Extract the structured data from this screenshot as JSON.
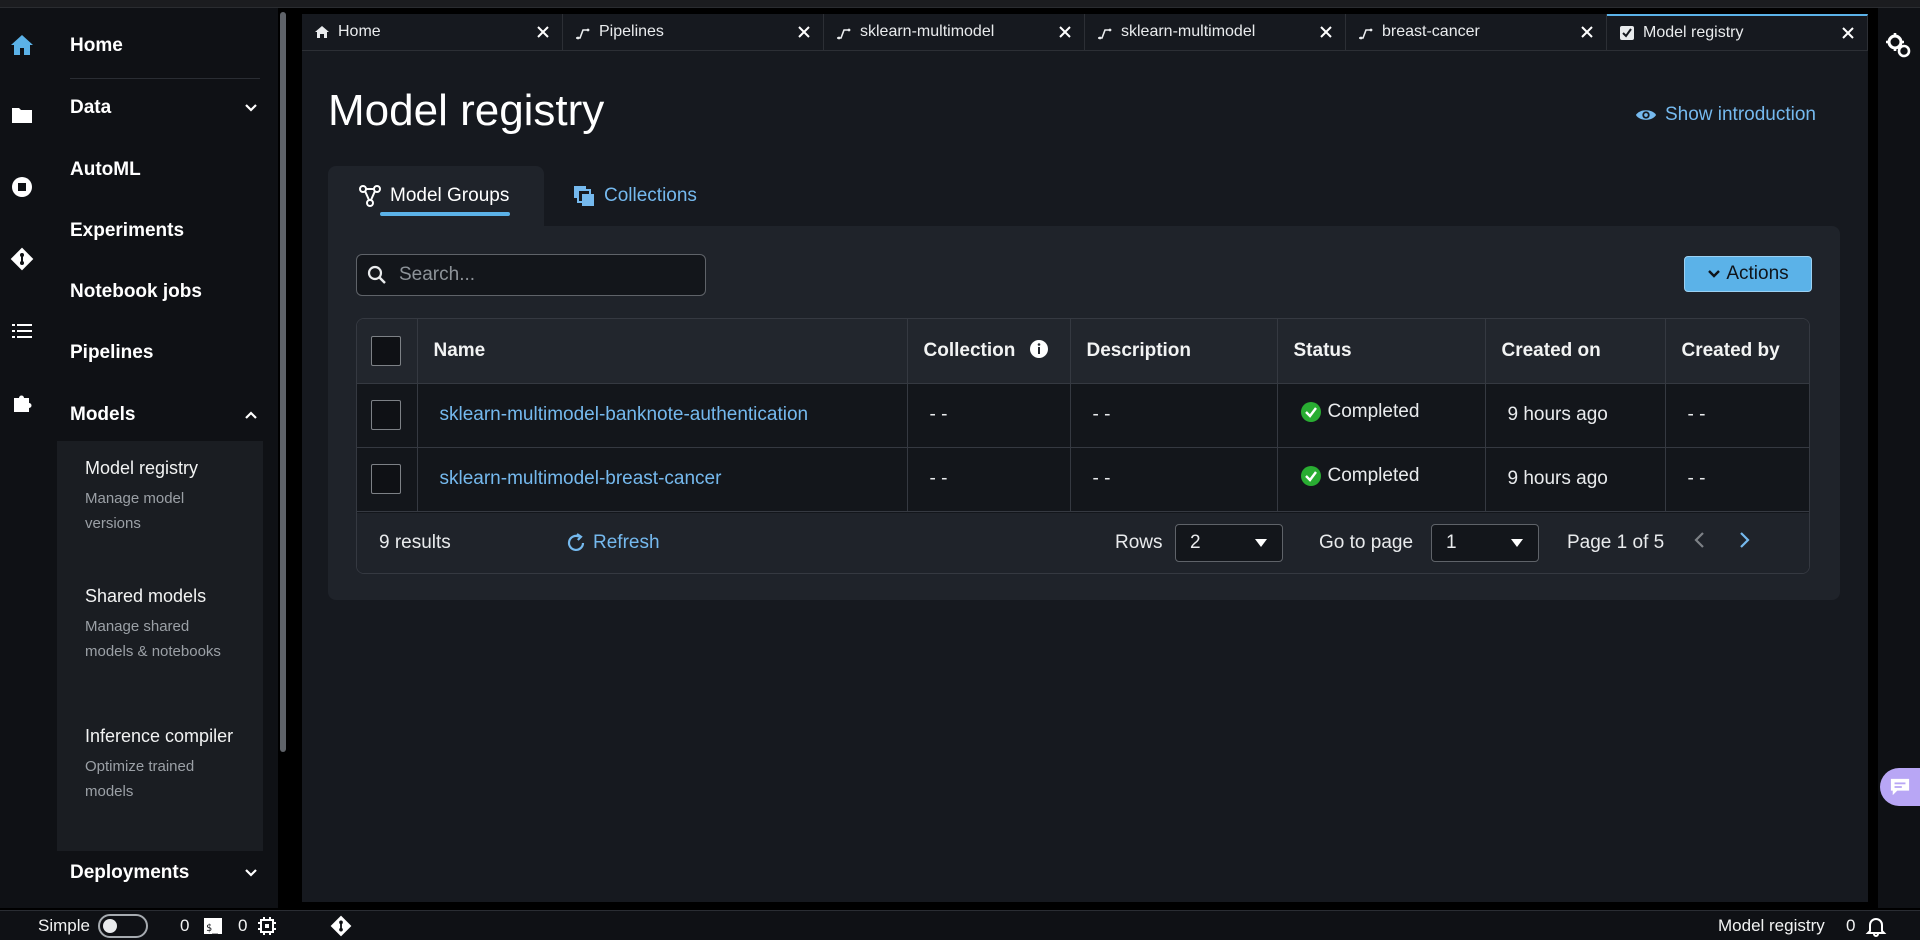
{
  "sidebar": {
    "home": "Home",
    "data": "Data",
    "automl": "AutoML",
    "experiments": "Experiments",
    "notebook_jobs": "Notebook jobs",
    "pipelines": "Pipelines",
    "models": "Models",
    "sub_items": [
      {
        "title": "Model registry",
        "desc": "Manage model versions"
      },
      {
        "title": "Shared models",
        "desc": "Manage shared models & notebooks"
      },
      {
        "title": "Inference compiler",
        "desc": "Optimize trained models"
      }
    ],
    "deployments": "Deployments"
  },
  "tabs": [
    {
      "label": "Home",
      "icon": "home-icon"
    },
    {
      "label": "Pipelines",
      "icon": "pipeline-icon"
    },
    {
      "label": "sklearn-multimodel",
      "icon": "pipeline-icon"
    },
    {
      "label": "sklearn-multimodel",
      "icon": "pipeline-icon"
    },
    {
      "label": "breast-cancer",
      "icon": "pipeline-icon"
    },
    {
      "label": "Model registry",
      "icon": "model-registry-icon",
      "active": true
    }
  ],
  "page": {
    "title": "Model registry",
    "show_intro": "Show introduction",
    "tab_groups": "Model Groups",
    "tab_collections": "Collections",
    "search_placeholder": "Search...",
    "actions": "Actions"
  },
  "table": {
    "columns": [
      "Name",
      "Collection",
      "Description",
      "Status",
      "Created on",
      "Created by"
    ],
    "rows": [
      {
        "name": "sklearn-multimodel-banknote-authentication",
        "collection": "- -",
        "description": "- -",
        "status": "Completed",
        "created_on": "9 hours ago",
        "created_by": "- -"
      },
      {
        "name": "sklearn-multimodel-breast-cancer",
        "collection": "- -",
        "description": "- -",
        "status": "Completed",
        "created_on": "9 hours ago",
        "created_by": "- -"
      }
    ]
  },
  "footer": {
    "results": "9 results",
    "refresh": "Refresh",
    "rows_label": "Rows",
    "rows_value": "2",
    "go_label": "Go to page",
    "go_value": "1",
    "page_info": "Page 1 of 5"
  },
  "statusbar": {
    "mode": "Simple",
    "count1": "0",
    "count2": "0",
    "right_label": "Model registry",
    "notif_count": "0"
  },
  "colors": {
    "accent": "#5bb2e8",
    "link": "#75b9ee",
    "success": "#29ad32",
    "chat": "#b8a6f5"
  }
}
